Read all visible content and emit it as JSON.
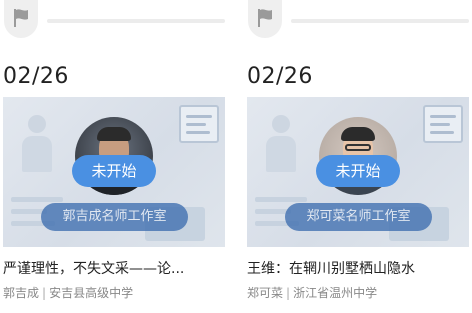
{
  "cards": [
    {
      "date": "02/26",
      "status": "未开始",
      "studio": "郭吉成名师工作室",
      "title": "严谨理性，不失文采——论...",
      "teacher": "郭吉成",
      "separator": "|",
      "school": "安吉县高级中学",
      "flag_icon": "flag-icon",
      "status_color": "#4a90e2"
    },
    {
      "date": "02/26",
      "status": "未开始",
      "studio": "郑可菜名师工作室",
      "title": "王维：在辋川别墅栖山隐水",
      "teacher": "郑可菜",
      "separator": "|",
      "school": "浙江省温州中学",
      "flag_icon": "flag-icon",
      "status_color": "#4a90e2"
    }
  ]
}
